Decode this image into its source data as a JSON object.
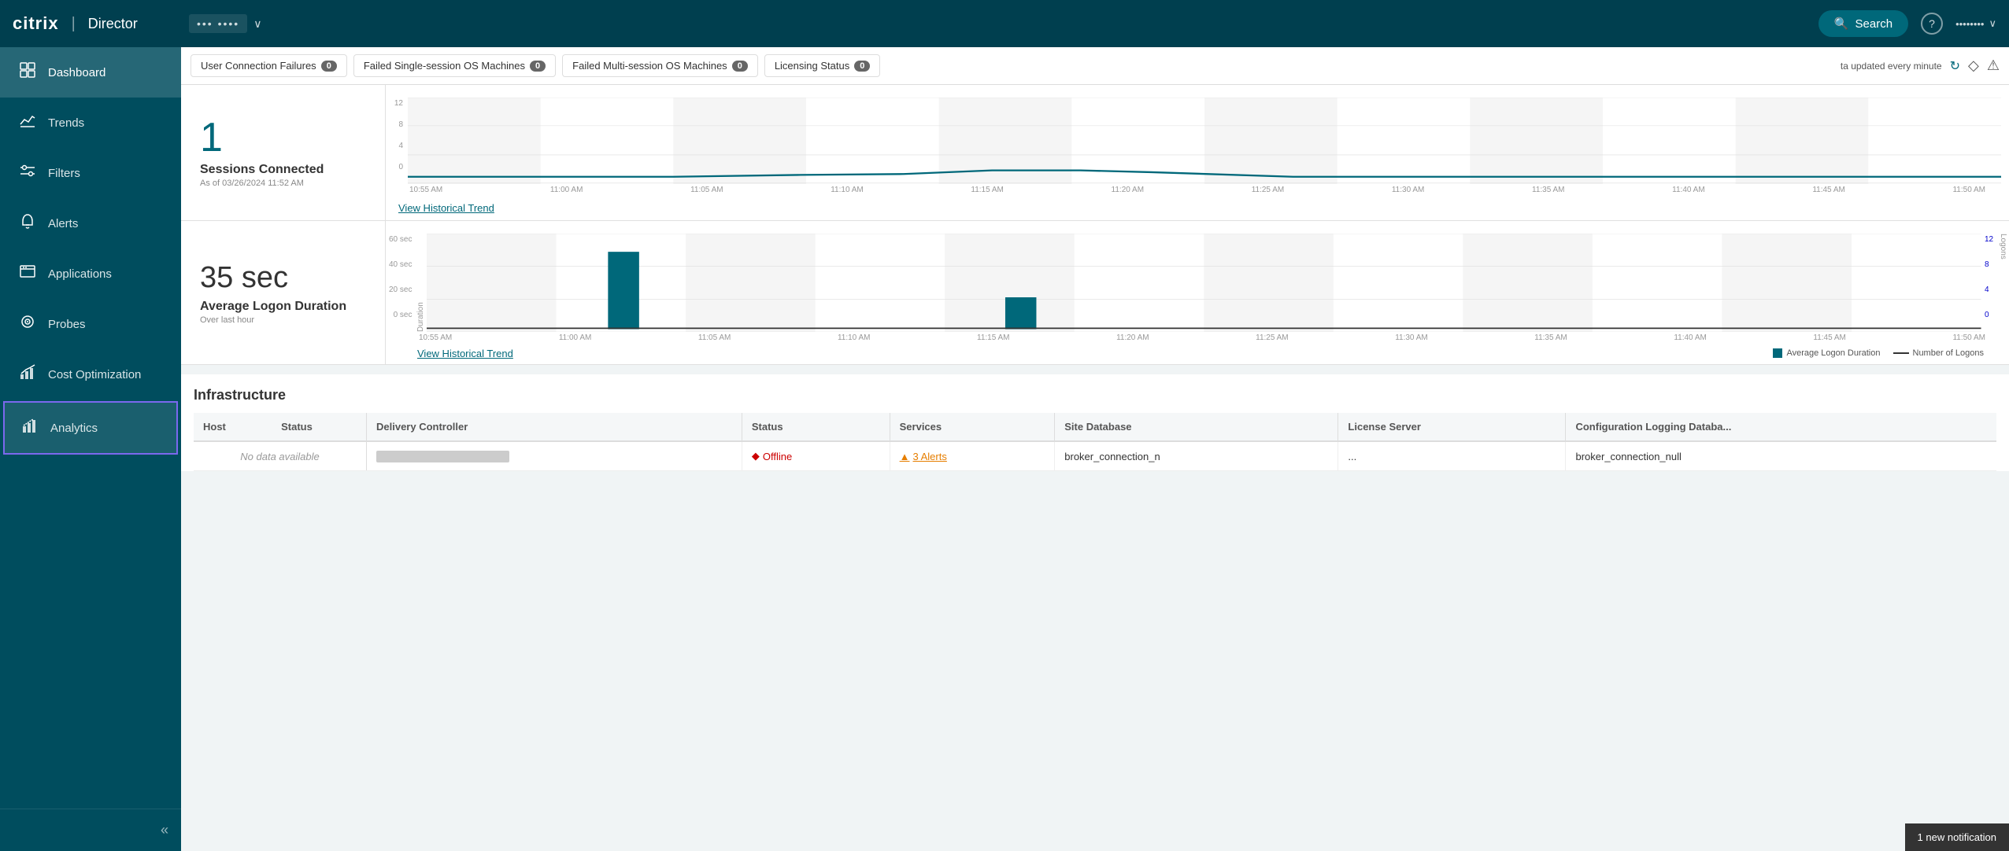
{
  "header": {
    "logo": "citrix",
    "app_name": "Director",
    "site_name": "•••  ••••",
    "search_label": "Search",
    "help_title": "?",
    "user_name": "••••••••",
    "chevron": "∨"
  },
  "nav": {
    "items": [
      {
        "id": "dashboard",
        "label": "Dashboard",
        "icon": "⊞",
        "active": true
      },
      {
        "id": "trends",
        "label": "Trends",
        "icon": "📈"
      },
      {
        "id": "filters",
        "label": "Filters",
        "icon": "⚙"
      },
      {
        "id": "alerts",
        "label": "Alerts",
        "icon": "🔔"
      },
      {
        "id": "applications",
        "label": "Applications",
        "icon": "🗃"
      },
      {
        "id": "probes",
        "label": "Probes",
        "icon": "⊙"
      },
      {
        "id": "cost_optimization",
        "label": "Cost Optimization",
        "icon": "📊"
      },
      {
        "id": "analytics",
        "label": "Analytics",
        "icon": "📉",
        "selected": true
      }
    ],
    "collapse_icon": "«"
  },
  "alert_bar": {
    "chips": [
      {
        "label": "User Connection Failures",
        "count": "0"
      },
      {
        "label": "Failed Single-session OS Machines",
        "count": "0"
      },
      {
        "label": "Failed Multi-session OS Machines",
        "count": "0"
      },
      {
        "label": "Licensing Status",
        "count": "0"
      }
    ],
    "update_text": "ta updated every minute",
    "refresh_icon": "↻",
    "diamond_icon": "◇",
    "warning_icon": "⚠"
  },
  "sessions_panel": {
    "value": "1",
    "label": "Sessions Connected",
    "sub": "As of 03/26/2024 11:52 AM",
    "view_trend": "View Historical Trend",
    "chart": {
      "y_labels": [
        "12",
        "8",
        "4",
        "0"
      ],
      "x_labels": [
        "10:55 AM",
        "11:00 AM",
        "11:05 AM",
        "11:10 AM",
        "11:15 AM",
        "11:20 AM",
        "11:25 AM",
        "11:30 AM",
        "11:35 AM",
        "11:40 AM",
        "11:45 AM",
        "11:50 AM"
      ]
    }
  },
  "logon_panel": {
    "value": "35 sec",
    "label": "Average Logon Duration",
    "sub": "Over last hour",
    "view_trend": "View Historical Trend",
    "chart": {
      "y_left_labels": [
        "60 sec",
        "40 sec",
        "20 sec",
        "0 sec"
      ],
      "y_right_labels": [
        "12",
        "8",
        "4",
        "0"
      ],
      "x_labels": [
        "10:55 AM",
        "11:00 AM",
        "11:05 AM",
        "11:10 AM",
        "11:15 AM",
        "11:20 AM",
        "11:25 AM",
        "11:30 AM",
        "11:35 AM",
        "11:40 AM",
        "11:45 AM",
        "11:50 AM"
      ],
      "y_left_axis": "Duration",
      "y_right_axis": "Logons"
    },
    "legend": {
      "bar_label": "Average Logon Duration",
      "line_label": "Number of Logons"
    }
  },
  "infrastructure": {
    "title": "Infrastructure",
    "host_columns": [
      "Host",
      "Status"
    ],
    "host_no_data": "No data available",
    "dc_columns": [
      "Delivery Controller",
      "Status",
      "Services",
      "Site Database",
      "License Server",
      "Configuration Logging Databa..."
    ],
    "dc_rows": [
      {
        "controller": "•• •••• ••••••••••••",
        "status": "Offline",
        "services": "3 Alerts",
        "site_database": "broker_connection_n",
        "license_server": "...",
        "config_logging": "broker_connection_null"
      }
    ]
  },
  "notification": {
    "label": "1 new notification"
  }
}
